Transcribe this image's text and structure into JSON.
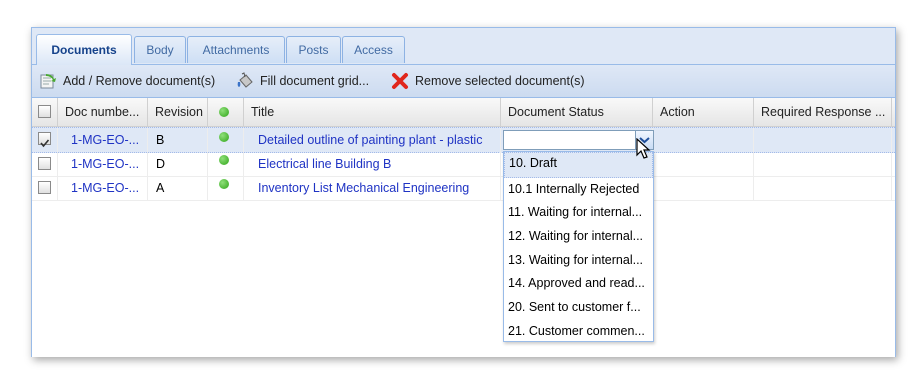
{
  "tabs": [
    {
      "label": "Documents",
      "active": true
    },
    {
      "label": "Body"
    },
    {
      "label": "Attachments"
    },
    {
      "label": "Posts"
    },
    {
      "label": "Access"
    }
  ],
  "toolbar": {
    "add_remove_label": "Add / Remove document(s)",
    "fill_grid_label": "Fill document grid...",
    "remove_selected_label": "Remove selected document(s)"
  },
  "grid": {
    "columns": {
      "doc_number": "Doc numbe...",
      "revision": "Revision",
      "title": "Title",
      "document_status": "Document Status",
      "action": "Action",
      "required_response": "Required Response ..."
    },
    "rows": [
      {
        "checked": true,
        "doc_number": "1-MG-EO-...",
        "revision": "B",
        "title": "Detailed outline of painting plant - plastic",
        "status_color": "#3cb521"
      },
      {
        "checked": false,
        "doc_number": "1-MG-EO-...",
        "revision": "D",
        "title": "Electrical line Building B",
        "status_color": "#3cb521"
      },
      {
        "checked": false,
        "doc_number": "1-MG-EO-...",
        "revision": "A",
        "title": "Inventory List Mechanical Engineering",
        "status_color": "#3cb521"
      }
    ]
  },
  "status_dropdown": {
    "current_value": "",
    "options": [
      "10. Draft",
      "10.1 Internally Rejected",
      "11. Waiting for internal...",
      "12. Waiting for internal...",
      "13. Waiting for internal...",
      "14. Approved and read...",
      "20. Sent to customer f...",
      "21. Customer commen..."
    ],
    "highlighted_index": 0
  }
}
